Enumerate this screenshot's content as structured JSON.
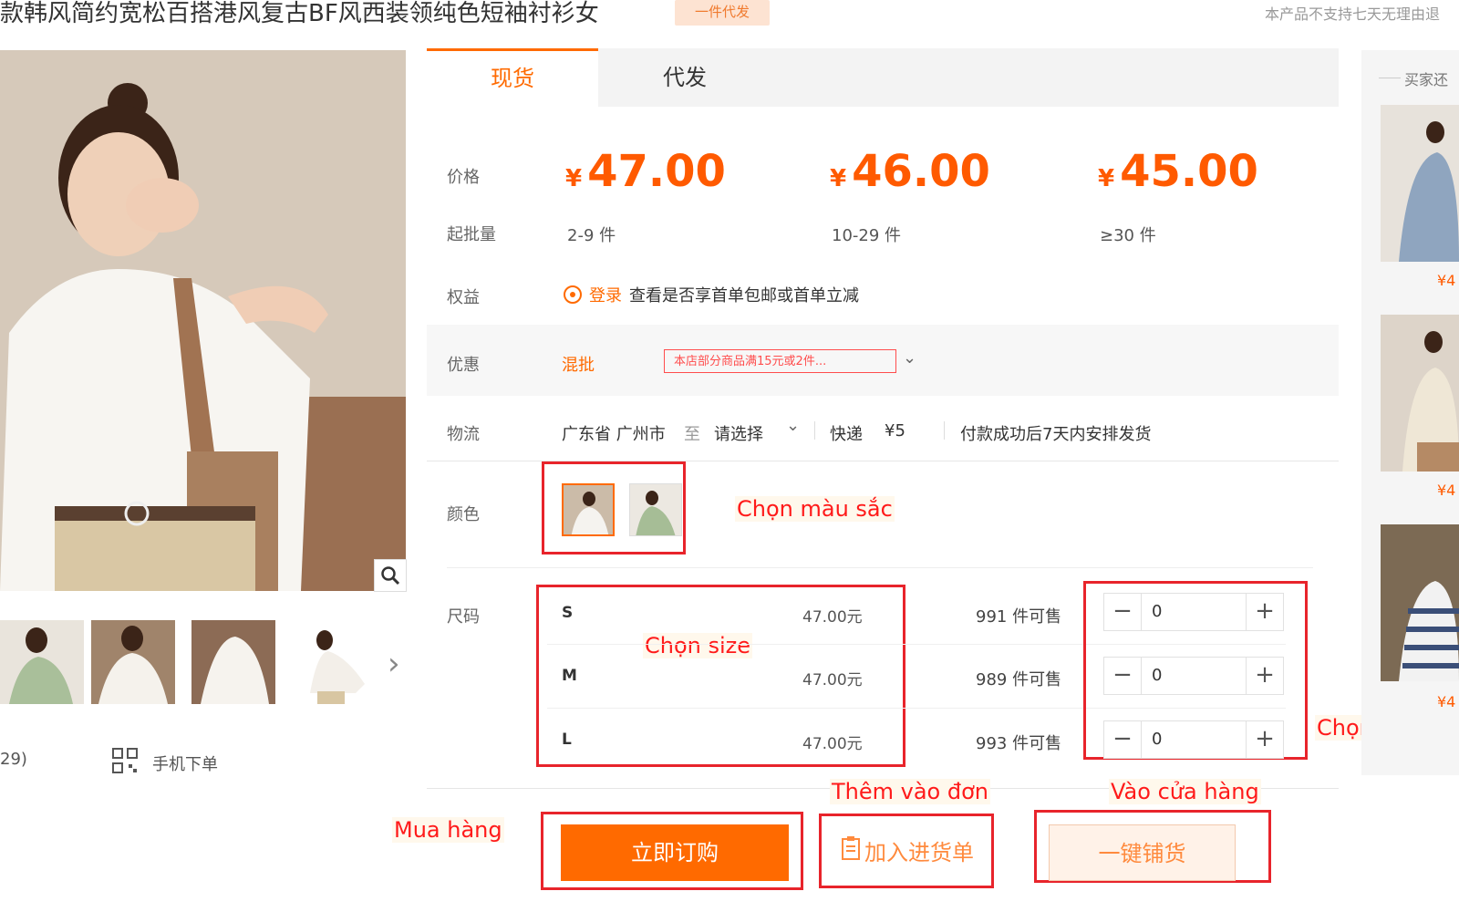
{
  "header": {
    "title": "款韩风简约宽松百搭港风复古BF风西装领纯色短袖衬衫女",
    "badge": "一件代发",
    "top_note": "本产品不支持七天无理由退"
  },
  "gallery": {
    "count_label": "29)",
    "mobile_order": "手机下单"
  },
  "tabs": [
    {
      "label": "现货",
      "active": true
    },
    {
      "label": "代发",
      "active": false
    }
  ],
  "pricing": {
    "price_label": "价格",
    "moq_label": "起批量",
    "currency": "¥",
    "tiers": [
      {
        "price": "47.00",
        "range": "2-9 件"
      },
      {
        "price": "46.00",
        "range": "10-29 件"
      },
      {
        "price": "45.00",
        "range": "≥30 件"
      }
    ]
  },
  "rights": {
    "label": "权益",
    "login": "登录",
    "text": "查看是否享首单包邮或首单立减"
  },
  "promotion": {
    "label": "优惠",
    "type": "混批",
    "tag": "本店部分商品满15元或2件..."
  },
  "logistics": {
    "label": "物流",
    "from": "广东省 广州市",
    "to_word": "至",
    "select": "请选择",
    "method": "快递",
    "fee": "¥5",
    "note": "付款成功后7天内安排发货"
  },
  "color": {
    "label": "颜色"
  },
  "size": {
    "label": "尺码",
    "rows": [
      {
        "name": "S",
        "price": "47.00元",
        "stock": "991 件可售",
        "qty": "0"
      },
      {
        "name": "M",
        "price": "47.00元",
        "stock": "989 件可售",
        "qty": "0"
      },
      {
        "name": "L",
        "price": "47.00元",
        "stock": "993 件可售",
        "qty": "0"
      }
    ]
  },
  "buttons": {
    "order": "立即订购",
    "cart": "加入进货单",
    "onekey": "一键铺货"
  },
  "annotations": {
    "color": "Chọn màu sắc",
    "size": "Chọn size",
    "quantity": "Chọn số lượng",
    "add": "Thêm vào đơn",
    "store": "Vào cửa hàng",
    "buy": "Mua hàng"
  },
  "right_column": {
    "title": "买家还",
    "prices": [
      "¥4",
      "¥4",
      "¥4"
    ]
  },
  "colors": {
    "accent": "#ff6a00",
    "annotation_red": "#e8242b"
  }
}
